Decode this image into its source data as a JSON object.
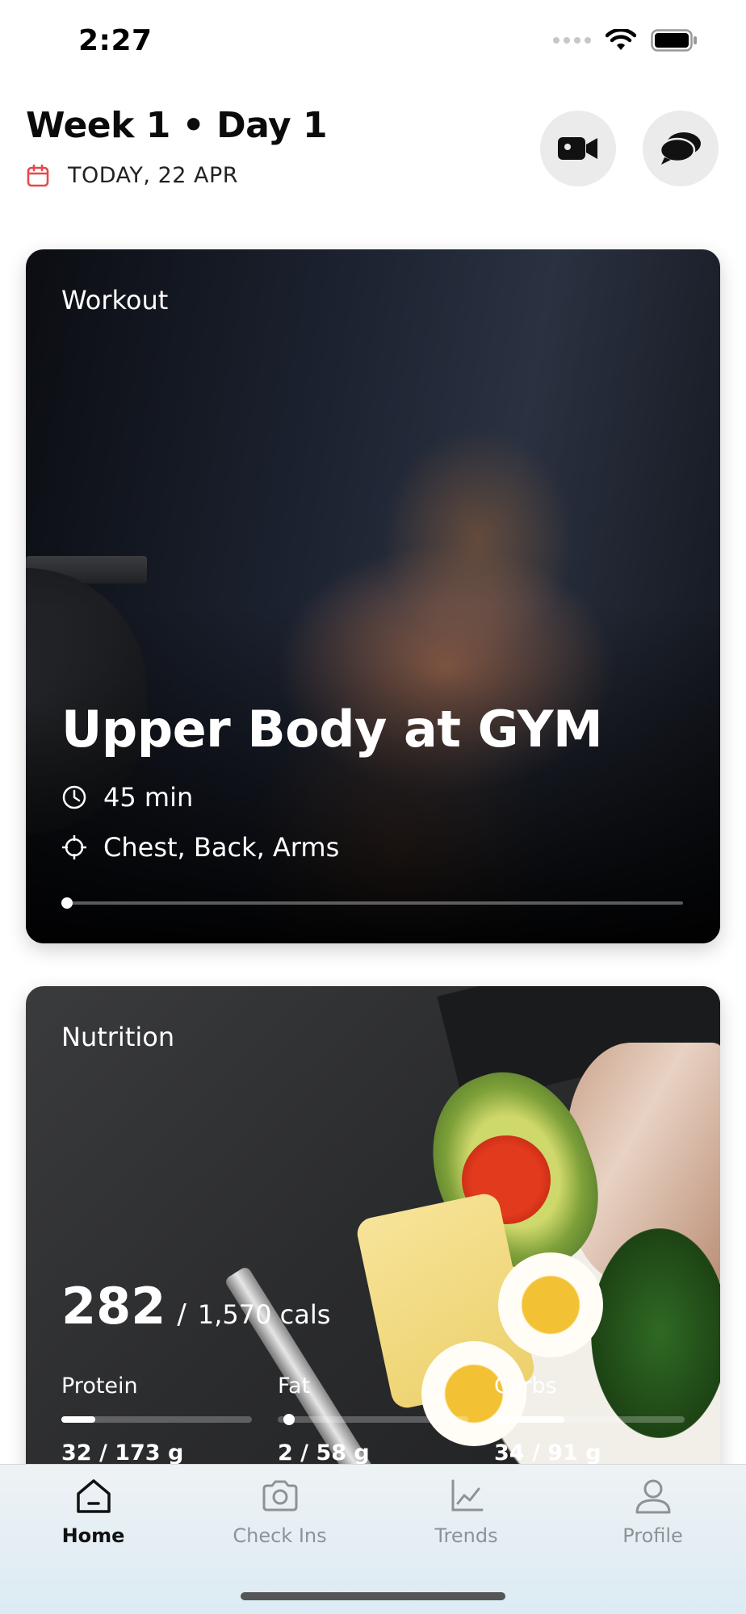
{
  "status_bar": {
    "time": "2:27"
  },
  "header": {
    "title": "Week 1 • Day 1",
    "date": "TODAY, 22 APR"
  },
  "workout": {
    "label": "Workout",
    "title": "Upper Body at GYM",
    "duration": "45 min",
    "muscles": "Chest, Back, Arms",
    "progress": 0
  },
  "nutrition": {
    "label": "Nutrition",
    "calories_consumed": "282",
    "separator": "/",
    "calories_target": "1,570 cals",
    "macros": [
      {
        "name": "Protein",
        "amount": "32 / 173 g",
        "fraction": 0.18
      },
      {
        "name": "Fat",
        "amount": "2 / 58 g",
        "fraction": 0.03
      },
      {
        "name": "Carbs",
        "amount": "34 / 91 g",
        "fraction": 0.37
      }
    ]
  },
  "tabs": [
    {
      "label": "Home",
      "icon": "home-icon",
      "active": true
    },
    {
      "label": "Check Ins",
      "icon": "camera-icon",
      "active": false
    },
    {
      "label": "Trends",
      "icon": "chart-icon",
      "active": false
    },
    {
      "label": "Profile",
      "icon": "user-icon",
      "active": false
    }
  ],
  "colors": {
    "accent_red": "#e5484d",
    "tab_inactive": "#8e9296",
    "tab_active": "#111111"
  }
}
